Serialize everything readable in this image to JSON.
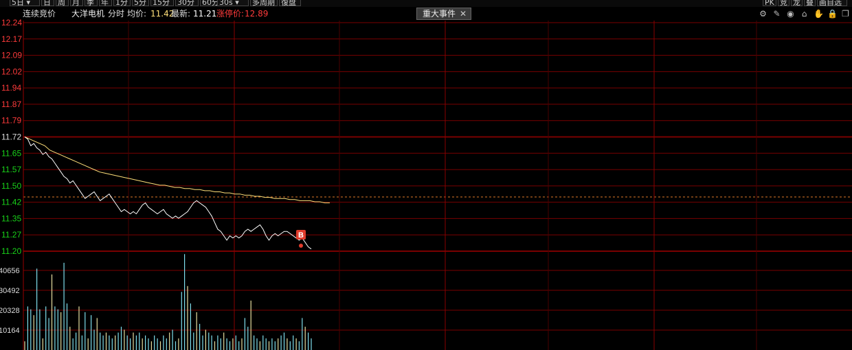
{
  "toolbar": {
    "period_select": "5日",
    "periods": [
      "日",
      "周",
      "月",
      "季",
      "年",
      "1分",
      "5分",
      "15分",
      "30分",
      "60分"
    ],
    "interval_select": "30s",
    "buttons": [
      "多周期",
      "復盘"
    ],
    "right_buttons": [
      "PK",
      "竞",
      "龙",
      "叠",
      "画自选"
    ]
  },
  "info": {
    "auction_label": "连续竞价",
    "stock_name": "大洋电机",
    "mode": "分时",
    "avg_label": "均价:",
    "avg_value": "11.42",
    "latest_label": "最新:",
    "latest_value": "11.21",
    "limit_label": "涨停价:",
    "limit_value": "12.89"
  },
  "event_tab": {
    "label": "重大事件",
    "close": "✕"
  },
  "icons": [
    "settings-icon",
    "pen-icon",
    "eye-icon",
    "basket-icon",
    "hand-icon",
    "lock-icon",
    "copy-icon"
  ],
  "colors": {
    "up": "#ff3b3b",
    "down": "#19d219",
    "price_line": "#ffffff",
    "avg_line": "#ffe07a",
    "volume": "#7fe0ee",
    "grid": "#7a0000",
    "marker": "#e03c2c"
  },
  "chart_data": {
    "type": "line",
    "prev_close": 11.72,
    "price_axis_ticks": [
      "12.24",
      "12.17",
      "12.09",
      "12.02",
      "11.94",
      "11.87",
      "11.79",
      "11.72",
      "11.65",
      "11.57",
      "11.50",
      "11.42",
      "11.35",
      "11.27",
      "11.20"
    ],
    "ylim": [
      11.2,
      12.24
    ],
    "volume_axis_ticks": [
      "40656",
      "30492",
      "20328",
      "10164"
    ],
    "series": [
      {
        "values": [
          11.72,
          11.71,
          11.68,
          11.69,
          11.67,
          11.66,
          11.64,
          11.65,
          11.63,
          11.62,
          11.6,
          11.58,
          11.56,
          11.54,
          11.53,
          11.51,
          11.52,
          11.5,
          11.48,
          11.46,
          11.44,
          11.45,
          11.46,
          11.47,
          11.45,
          11.43,
          11.44,
          11.45,
          11.46,
          11.44,
          11.42,
          11.4,
          11.38,
          11.39,
          11.38,
          11.37,
          11.38,
          11.37,
          11.39,
          11.41,
          11.42,
          11.4,
          11.39,
          11.38,
          11.37,
          11.38,
          11.39,
          11.37,
          11.36,
          11.35,
          11.36,
          11.35,
          11.36,
          11.37,
          11.38,
          11.4,
          11.42,
          11.43,
          11.42,
          11.41,
          11.4,
          11.38,
          11.36,
          11.33,
          11.3,
          11.29,
          11.27,
          11.25,
          11.27,
          11.26,
          11.27,
          11.26,
          11.27,
          11.29,
          11.3,
          11.29,
          11.3,
          11.31,
          11.32,
          11.3,
          11.27,
          11.25,
          11.27,
          11.28,
          11.27,
          11.28,
          11.29,
          11.29,
          11.28,
          11.27,
          11.26,
          11.25,
          11.26,
          11.24,
          11.22,
          11.21
        ]
      },
      {
        "values": [
          11.72,
          11.71,
          11.7,
          11.69,
          11.68,
          11.66,
          11.65,
          11.64,
          11.63,
          11.62,
          11.61,
          11.6,
          11.59,
          11.58,
          11.57,
          11.56,
          11.555,
          11.55,
          11.545,
          11.54,
          11.535,
          11.53,
          11.525,
          11.52,
          11.515,
          11.51,
          11.505,
          11.5,
          11.5,
          11.495,
          11.49,
          11.49,
          11.485,
          11.485,
          11.48,
          11.48,
          11.475,
          11.475,
          11.47,
          11.47,
          11.465,
          11.465,
          11.46,
          11.46,
          11.455,
          11.455,
          11.45,
          11.45,
          11.445,
          11.445,
          11.44,
          11.44,
          11.44,
          11.435,
          11.435,
          11.43,
          11.43,
          11.43,
          11.425,
          11.425,
          11.42,
          11.42
        ]
      }
    ],
    "volume": [
      3,
      15,
      14,
      12,
      28,
      14,
      4,
      15,
      11,
      26,
      15,
      14,
      13,
      30,
      16,
      8,
      4,
      6,
      15,
      5,
      13,
      4,
      12,
      7,
      11,
      6,
      5,
      6,
      5,
      4,
      5,
      6,
      8,
      7,
      5,
      4,
      6,
      5,
      6,
      4,
      5,
      4,
      3,
      5,
      4,
      3,
      5,
      4,
      6,
      7,
      3,
      4,
      20,
      33,
      22,
      16,
      6,
      13,
      9,
      5,
      7,
      6,
      5,
      3,
      5,
      4,
      6,
      4,
      3,
      4,
      5,
      3,
      4,
      11,
      8,
      17,
      5,
      4,
      3,
      5,
      4,
      3,
      4,
      3,
      4,
      5,
      6,
      4,
      3,
      5,
      4,
      3,
      11,
      8,
      6,
      4
    ]
  }
}
